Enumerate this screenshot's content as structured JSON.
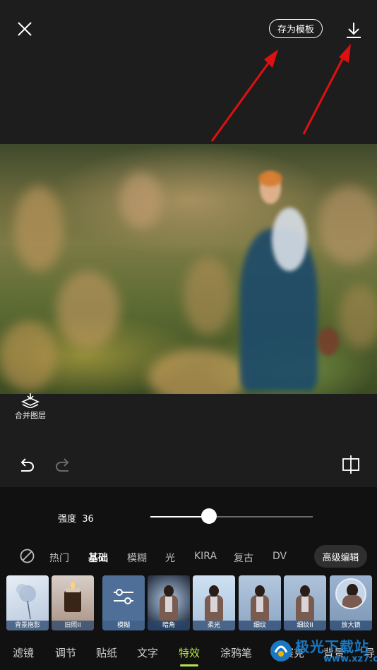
{
  "header": {
    "save_template_label": "存为模板"
  },
  "canvas_tools": {
    "merge_layers_label": "合并图层"
  },
  "adjust": {
    "strength_label": "强度",
    "strength_value": "36",
    "strength_fraction": 0.36
  },
  "categories": {
    "items": [
      "热门",
      "基础",
      "模糊",
      "光",
      "KIRA",
      "复古",
      "DV"
    ],
    "active": "基础",
    "advanced_edit_label": "高级编辑"
  },
  "effects": {
    "items": [
      {
        "label": "背景拖影"
      },
      {
        "label": "旧照II"
      },
      {
        "label": "模糊"
      },
      {
        "label": "暗角"
      },
      {
        "label": "柔光"
      },
      {
        "label": "细纹"
      },
      {
        "label": "细纹II"
      },
      {
        "label": "放大镜"
      }
    ]
  },
  "bottom_nav": {
    "items": [
      "滤镜",
      "调节",
      "贴纸",
      "文字",
      "特效",
      "涂鸦笔",
      "马赛克",
      "背景",
      "导"
    ],
    "active": "特效"
  },
  "watermark": {
    "name": "极光下载站",
    "url": "www.xz7.com"
  },
  "colors": {
    "accent": "#b7e64a",
    "annotation_arrow": "#e01010",
    "background": "#1d1d1d"
  }
}
